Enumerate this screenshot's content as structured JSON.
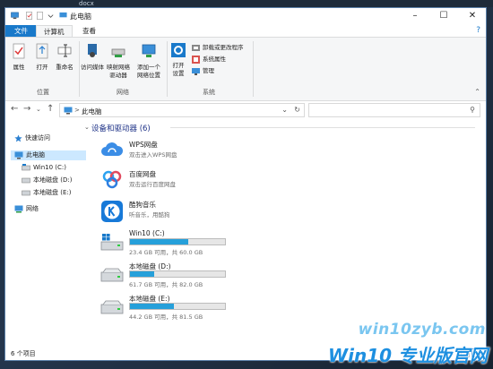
{
  "desktop": {
    "label": "docx"
  },
  "window": {
    "title": "此电脑"
  },
  "tabs": {
    "file": "文件",
    "computer": "计算机",
    "view": "查看"
  },
  "ribbon": {
    "location": {
      "label": "位置",
      "properties": "属性",
      "open": "打开",
      "rename": "重命名"
    },
    "network": {
      "label": "网络",
      "access_media": "访问媒体",
      "map_drive_1": "映射网络",
      "map_drive_2": "驱动器",
      "add_location_1": "添加一个",
      "add_location_2": "网络位置"
    },
    "system": {
      "label": "系统",
      "open_settings_1": "打开",
      "open_settings_2": "设置",
      "uninstall": "卸载或更改程序",
      "system_properties": "系统属性",
      "manage": "管理"
    }
  },
  "address": {
    "path": "此电脑",
    "separator": ">"
  },
  "nav": {
    "quick_access": "快速访问",
    "this_pc": "此电脑",
    "win10_c": "Win10 (C:)",
    "local_d": "本地磁盘 (D:)",
    "local_e": "本地磁盘 (E:)",
    "network": "网络"
  },
  "content": {
    "group_title": "设备和驱动器 (6)",
    "apps": [
      {
        "name": "WPS网盘",
        "desc": "双击进入WPS网盘"
      },
      {
        "name": "百度网盘",
        "desc": "双击运行百度网盘"
      },
      {
        "name": "酷狗音乐",
        "desc": "听音乐，用酷狗"
      }
    ],
    "drives": [
      {
        "name": "Win10 (C:)",
        "space": "23.4 GB 可用，共 60.0 GB",
        "used_fraction": 0.61
      },
      {
        "name": "本地磁盘 (D:)",
        "space": "61.7 GB 可用，共 82.0 GB",
        "used_fraction": 0.25
      },
      {
        "name": "本地磁盘 (E:)",
        "space": "44.2 GB 可用，共 81.5 GB",
        "used_fraction": 0.46
      }
    ]
  },
  "status": {
    "count": "6 个项目"
  },
  "watermark": {
    "url": "win10zyb.com",
    "brand": "Win10 专业版官网"
  },
  "colors": {
    "accent": "#1979ca",
    "bar_fill": "#26a0da",
    "group_title": "#1e3287"
  }
}
